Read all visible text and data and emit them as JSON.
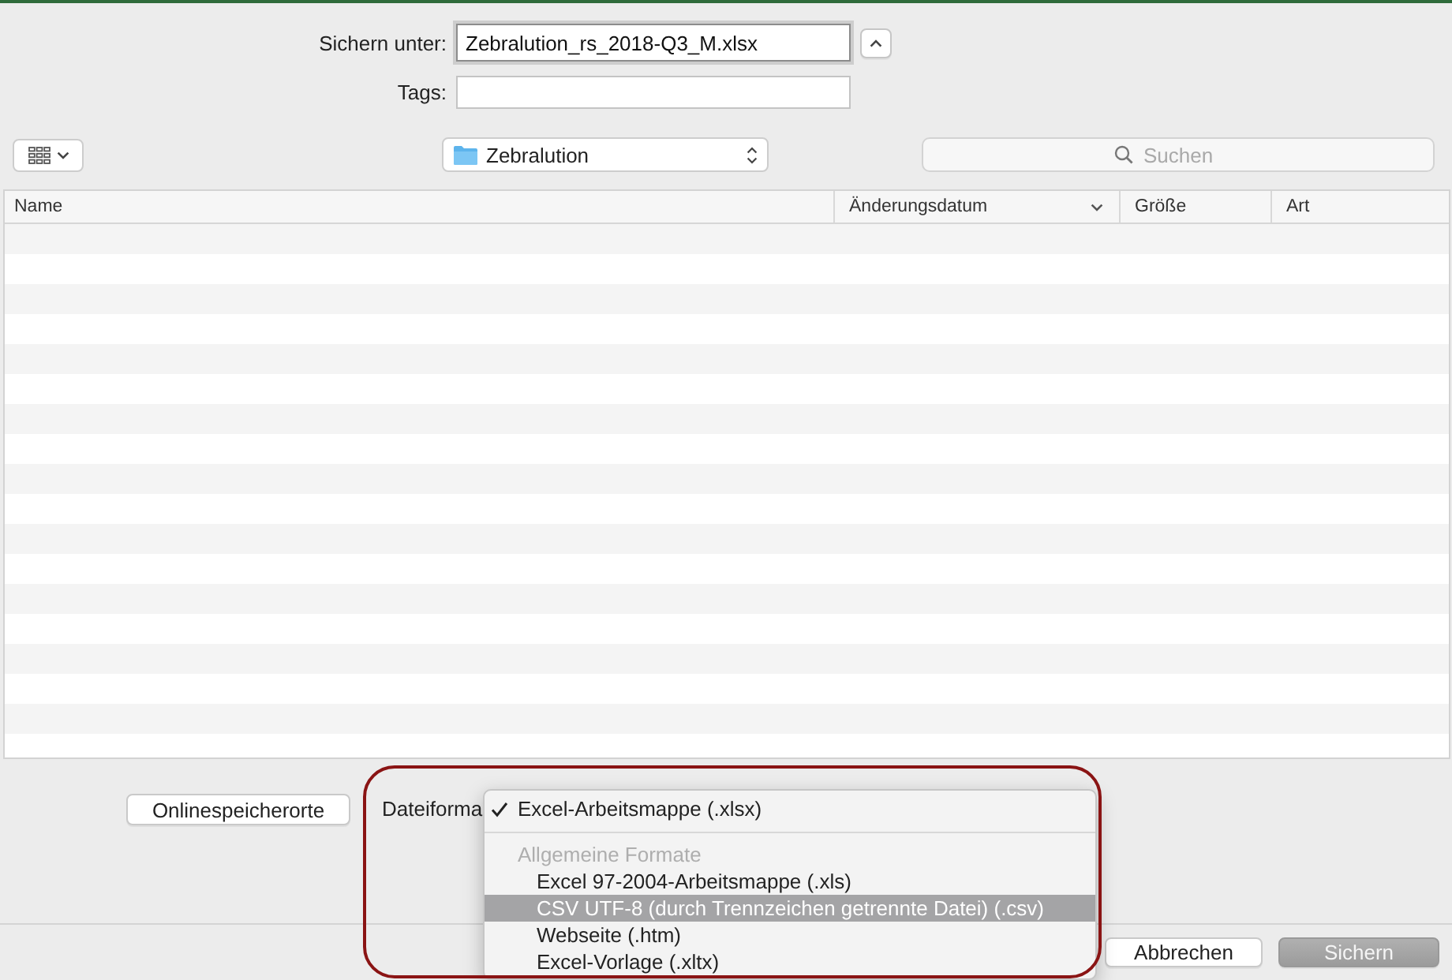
{
  "save_form": {
    "save_as": {
      "label": "Sichern unter:",
      "value": "Zebralution_rs_2018-Q3_M.xlsx",
      "focused": true
    },
    "tags": {
      "label": "Tags:"
    }
  },
  "toolbar": {
    "location": "Zebralution",
    "search": {
      "placeholder": "Suchen"
    }
  },
  "file_list": {
    "columns": [
      {
        "label": "Name",
        "sorted": false
      },
      {
        "label": "Änderungsdatum",
        "sorted": true
      },
      {
        "label": "Größe",
        "sorted": false
      },
      {
        "label": "Art",
        "sorted": false
      }
    ]
  },
  "footer": {
    "online_button": "Onlinespeicherorte",
    "format_label": "Dateiforma",
    "format_menu": {
      "top_options": [
        {
          "label": "Excel-Arbeitsmappe (.xlsx)",
          "checked": true,
          "highlighted": false
        }
      ],
      "sections": [
        {
          "header": "Allgemeine Formate",
          "options": [
            {
              "label": "Excel 97-2004-Arbeitsmappe (.xls)",
              "checked": false,
              "highlighted": false
            },
            {
              "label": "CSV UTF-8 (durch Trennzeichen getrennte Datei) (.csv)",
              "checked": false,
              "highlighted": true
            },
            {
              "label": "Webseite (.htm)",
              "checked": false,
              "highlighted": false
            },
            {
              "label": "Excel-Vorlage (.xltx)",
              "checked": false,
              "highlighted": false
            }
          ]
        }
      ]
    },
    "buttons": [
      {
        "label": "Abbrechen",
        "kind": "normal"
      },
      {
        "label": "Sichern",
        "kind": "default"
      }
    ]
  },
  "annotation": {
    "kind": "rounded-frame"
  }
}
